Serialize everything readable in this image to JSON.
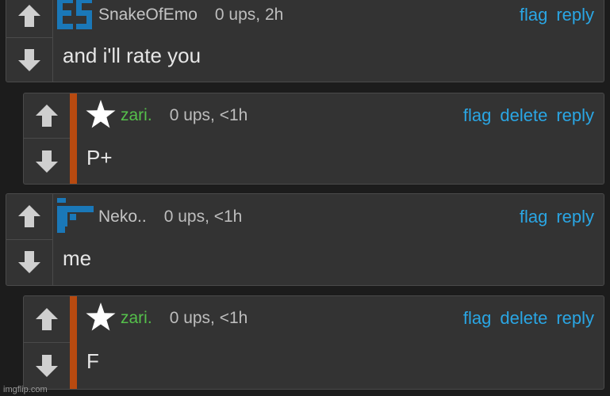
{
  "comments": [
    {
      "username": "SnakeOfEmo",
      "meta": "0 ups, 2h",
      "text": "and i'll rate you",
      "avatar": "es-icon",
      "actions": [
        "flag",
        "reply"
      ]
    },
    {
      "username": "zari.",
      "meta": "0 ups, <1h",
      "text": "P+",
      "avatar": "star-icon",
      "actions": [
        "flag",
        "delete",
        "reply"
      ]
    },
    {
      "username": "Neko..",
      "meta": "0 ups, <1h",
      "text": "me",
      "avatar": "pixel-avatar-icon",
      "actions": [
        "flag",
        "reply"
      ]
    },
    {
      "username": "zari.",
      "meta": "0 ups, <1h",
      "text": "F",
      "avatar": "star-icon",
      "actions": [
        "flag",
        "delete",
        "reply"
      ]
    }
  ],
  "watermark": "imgflip.com",
  "colors": {
    "background": "#1c1c1c",
    "panel": "#333333",
    "link": "#2aa6e4",
    "mod_name": "#55c04b",
    "reply_bar": "#b84a10",
    "avatar_blue": "#1a78b8"
  }
}
